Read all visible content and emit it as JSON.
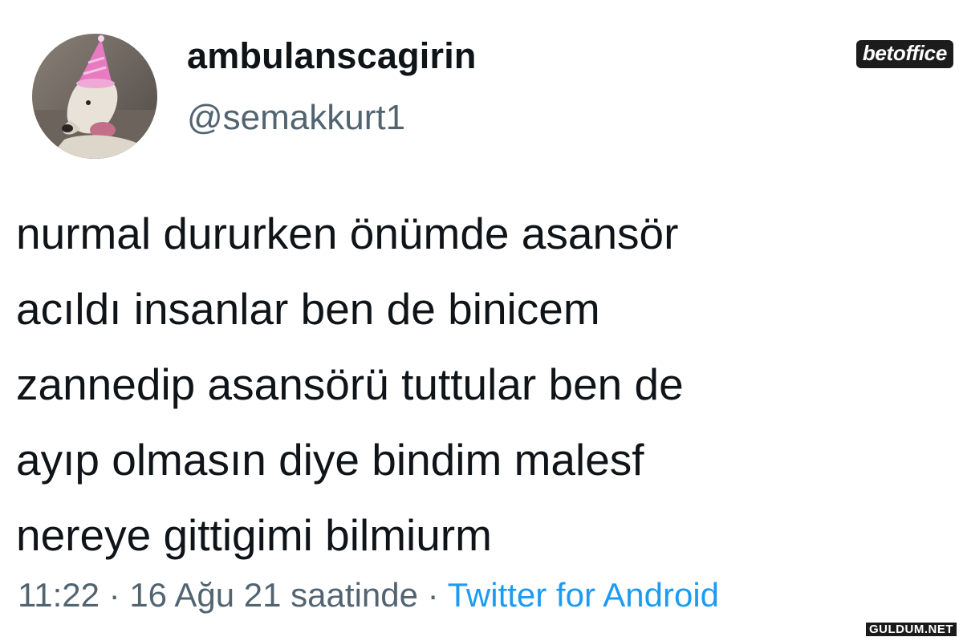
{
  "user": {
    "display_name": "ambulanscagirin",
    "handle": "@semakkurt1",
    "avatar_icon": "dog-with-party-hat-avatar"
  },
  "tweet": {
    "lines": [
      "nurmal dururken önümde asansör",
      "acıldı insanlar ben de binicem",
      "zannedip asansörü tuttular ben de",
      "ayıp olmasın diye bindim malesf",
      "nereye gittigimi bilmiurm"
    ]
  },
  "meta": {
    "time": "11:22",
    "separator": " · ",
    "date": "16 Ağu 21 saatinde",
    "source": "Twitter for Android"
  },
  "brand_badge": "betoffice",
  "watermark": "GULDUM.NET",
  "colors": {
    "text": "#0f1419",
    "secondary": "#536471",
    "link": "#1d9bf0",
    "background": "#ffffff"
  }
}
